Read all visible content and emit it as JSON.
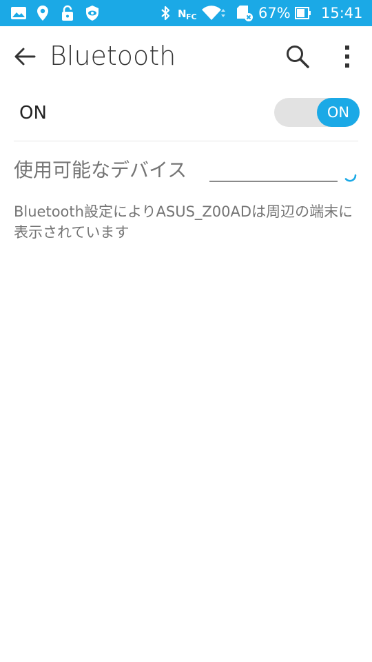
{
  "status_bar": {
    "icons": [
      "image-icon",
      "location-icon",
      "lock-open-icon",
      "shield-eye-icon",
      "bluetooth-icon",
      "nfc-icon",
      "wifi-icon",
      "sd-card-icon"
    ],
    "battery_percent": "67%",
    "time": "15:41",
    "colors": {
      "background": "#1ba9e6"
    }
  },
  "appbar": {
    "title": "Bluetooth",
    "icons": [
      "arrow-back-icon",
      "search-icon",
      "more-vert-icon"
    ]
  },
  "toggle": {
    "label": "ON",
    "switch_text": "ON",
    "state": "on",
    "colors": {
      "accent": "#1ba9e6",
      "track": "#e2e2e2"
    }
  },
  "devices": {
    "section_title": "使用可能なデバイス",
    "info_text": "Bluetooth設定によりASUS_Z00ADは周辺の端末に表示されています"
  }
}
